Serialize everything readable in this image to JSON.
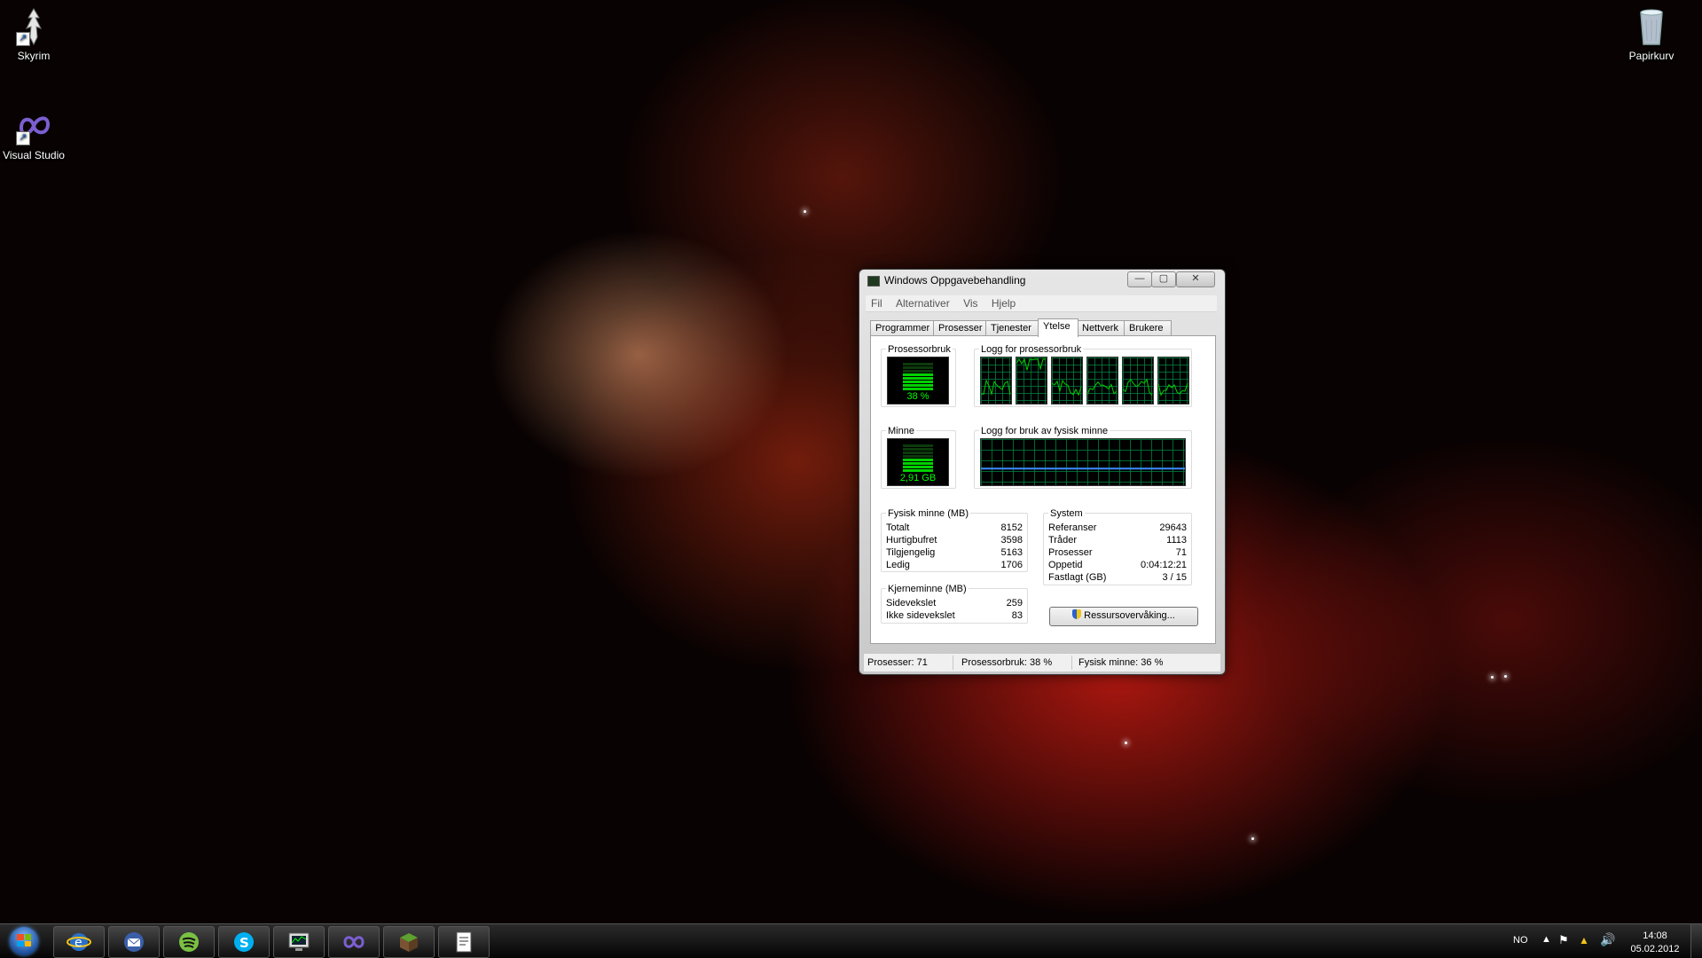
{
  "desktop": {
    "icons": [
      {
        "label": "Skyrim"
      },
      {
        "label": "Visual Studio"
      },
      {
        "label": "Papirkurv"
      }
    ]
  },
  "taskmanager": {
    "title": "Windows Oppgavebehandling",
    "menu": [
      "Fil",
      "Alternativer",
      "Vis",
      "Hjelp"
    ],
    "tabs": [
      "Programmer",
      "Prosesser",
      "Tjenester",
      "Ytelse",
      "Nettverk",
      "Brukere"
    ],
    "active_tab": "Ytelse",
    "cpu_usage": {
      "label": "Prosessorbruk",
      "value": "38 %",
      "fraction": 0.38
    },
    "cpu_history": {
      "label": "Logg for prosessorbruk",
      "cores": 6
    },
    "memory": {
      "label": "Minne",
      "value": "2,91 GB",
      "fraction": 0.36
    },
    "memory_history": {
      "label": "Logg for bruk av fysisk minne"
    },
    "physical_memory": {
      "title": "Fysisk minne (MB)",
      "rows": [
        {
          "label": "Totalt",
          "value": "8152"
        },
        {
          "label": "Hurtigbufret",
          "value": "3598"
        },
        {
          "label": "Tilgjengelig",
          "value": "5163"
        },
        {
          "label": "Ledig",
          "value": "1706"
        }
      ]
    },
    "kernel_memory": {
      "title": "Kjerneminne (MB)",
      "rows": [
        {
          "label": "Sidevekslet",
          "value": "259"
        },
        {
          "label": "Ikke sidevekslet",
          "value": "83"
        }
      ]
    },
    "system": {
      "title": "System",
      "rows": [
        {
          "label": "Referanser",
          "value": "29643"
        },
        {
          "label": "Tråder",
          "value": "1113"
        },
        {
          "label": "Prosesser",
          "value": "71"
        },
        {
          "label": "Oppetid",
          "value": "0:04:12:21"
        },
        {
          "label": "Fastlagt (GB)",
          "value": "3 / 15"
        }
      ]
    },
    "resource_monitor_button": "Ressursovervåking...",
    "status": {
      "processes": "Prosesser: 71",
      "cpu": "Prosessorbruk: 38 %",
      "memory": "Fysisk minne: 36 %"
    }
  },
  "taskbar": {
    "language": "NO",
    "time": "14:08",
    "date": "05.02.2012",
    "pinned": [
      "internet-explorer",
      "thunderbird",
      "spotify",
      "skype",
      "task-manager",
      "visual-studio",
      "minecraft",
      "text-editor"
    ]
  },
  "colors": {
    "graph_green": "#00d200",
    "graph_grid": "#008040",
    "memory_line": "#3b8cff"
  }
}
